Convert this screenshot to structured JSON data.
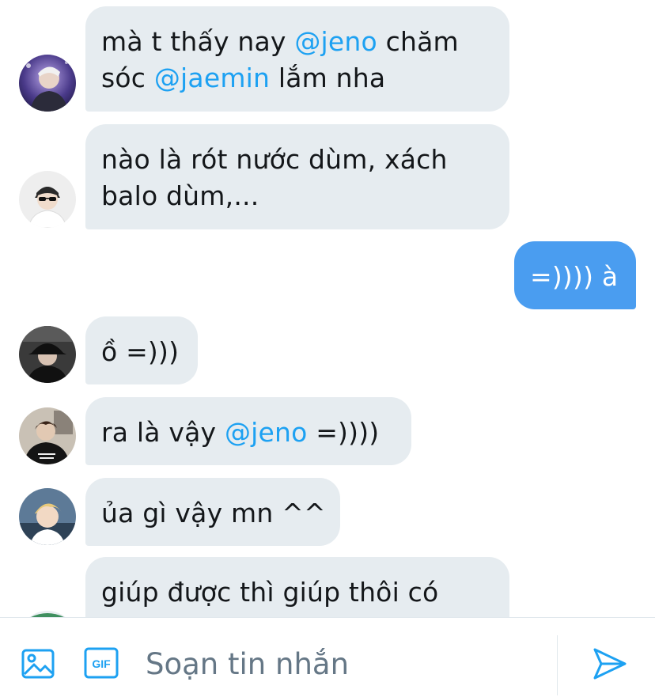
{
  "conversation": {
    "messages": [
      {
        "direction": "in",
        "avatar": "avatar-haechan",
        "lines": [
          [
            {
              "t": "mà t thấy nay "
            },
            {
              "t": "@jeno",
              "m": true
            },
            {
              "t": " chăm"
            }
          ],
          [
            {
              "t": "sóc "
            },
            {
              "t": "@jaemin",
              "m": true
            },
            {
              "t": " lắm nha"
            }
          ]
        ]
      },
      {
        "direction": "in",
        "avatar": "avatar-sunglasses",
        "lines": [
          [
            {
              "t": "nào là rót nước dùm, xách"
            }
          ],
          [
            {
              "t": "balo dùm,..."
            }
          ]
        ]
      },
      {
        "direction": "out",
        "lines": [
          [
            {
              "t": "=)))) à"
            }
          ]
        ]
      },
      {
        "direction": "in",
        "avatar": "avatar-black-hat",
        "lines": [
          [
            {
              "t": "ồ =)))"
            }
          ]
        ]
      },
      {
        "direction": "in",
        "avatar": "avatar-black-hoodie",
        "lines": [
          [
            {
              "t": "ra là vậy "
            },
            {
              "t": "@jeno",
              "m": true
            },
            {
              "t": " =))))"
            }
          ]
        ]
      },
      {
        "direction": "in",
        "avatar": "avatar-blonde",
        "lines": [
          [
            {
              "t": "ủa gì vậy mn ^^"
            }
          ]
        ]
      },
      {
        "direction": "in",
        "avatar": "avatar-partial",
        "lines": [
          [
            {
              "t": "giúp được thì giúp thôi có"
            }
          ]
        ]
      }
    ]
  },
  "composer": {
    "placeholder": "Soạn tin nhắn",
    "gif_label": "GIF",
    "icons": {
      "image": "image-icon",
      "gif": "gif-icon",
      "send": "send-icon"
    }
  },
  "colors": {
    "incoming_bubble": "#e6ecf0",
    "outgoing_bubble": "#4a9df0",
    "mention": "#1da1f2",
    "icon": "#1da1f2",
    "placeholder": "#657786"
  }
}
